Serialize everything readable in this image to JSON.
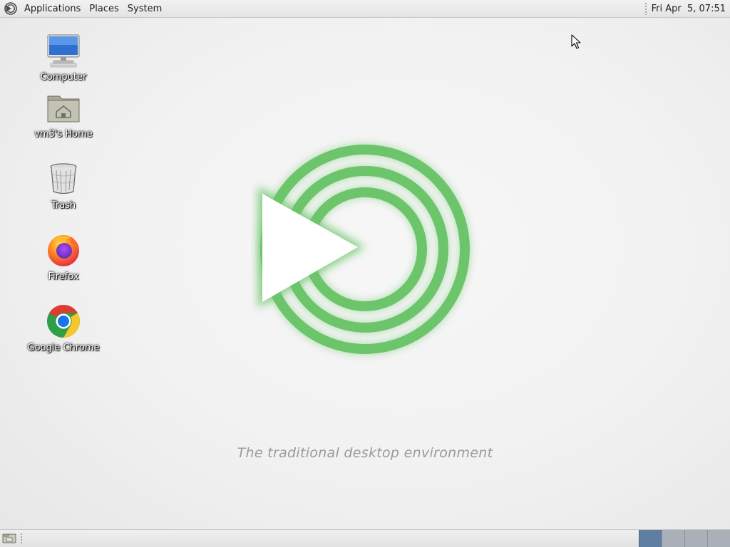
{
  "top_panel": {
    "menu": [
      {
        "label": "Applications"
      },
      {
        "label": "Places"
      },
      {
        "label": "System"
      }
    ],
    "clock": "Fri Apr  5, 07:51"
  },
  "desktop_icons": [
    {
      "label": "Computer",
      "icon": "computer-icon"
    },
    {
      "label": "vm3's Home",
      "icon": "home-folder-icon"
    },
    {
      "label": "Trash",
      "icon": "trash-icon"
    },
    {
      "label": "Firefox",
      "icon": "firefox-icon"
    },
    {
      "label": "Google Chrome",
      "icon": "chrome-icon"
    }
  ],
  "wallpaper": {
    "tagline": "The traditional desktop environment",
    "logo": "mate-logo",
    "accent_color": "#6cc56a"
  },
  "bottom_panel": {
    "show_desktop_icon": "show-desktop-icon",
    "workspaces": [
      {
        "active": true
      },
      {
        "active": false
      },
      {
        "active": false
      },
      {
        "active": false
      }
    ]
  },
  "colors": {
    "panel_bg": "#e8e8e8",
    "desktop_bg": "#f1f1f1",
    "workspace_active": "#5e7ea2",
    "workspace_inactive": "#aab0b7"
  }
}
